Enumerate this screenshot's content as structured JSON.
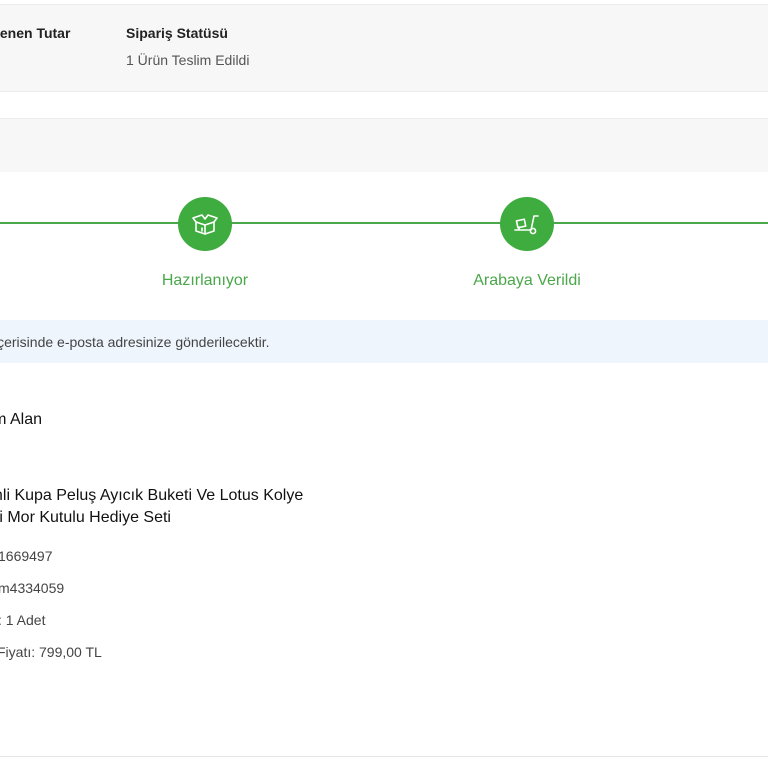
{
  "summary": {
    "paid_label": "lenen Tutar",
    "status_label": "Sipariş Statüsü",
    "status_value": "1 Ürün Teslim Edildi"
  },
  "tracker": {
    "steps": [
      {
        "label": "Hazırlanıyor",
        "icon": "box-icon"
      },
      {
        "label": "Arabaya Verildi",
        "icon": "cart-icon"
      }
    ],
    "color": "#3eac3e"
  },
  "info": {
    "text": "içerisinde e-posta adresinize gönderilecektir."
  },
  "order": {
    "recipient": "lim Alan",
    "product_line1": "simli Kupa Peluş Ayıcık Buketi Ve Lotus Kolye",
    "product_line2": "keti Mor Kutulu Hediye Seti",
    "detail1": "1669497",
    "detail2": "m4334059",
    "quantity": ": 1 Adet",
    "price": "Fiyatı: 799,00 TL"
  }
}
